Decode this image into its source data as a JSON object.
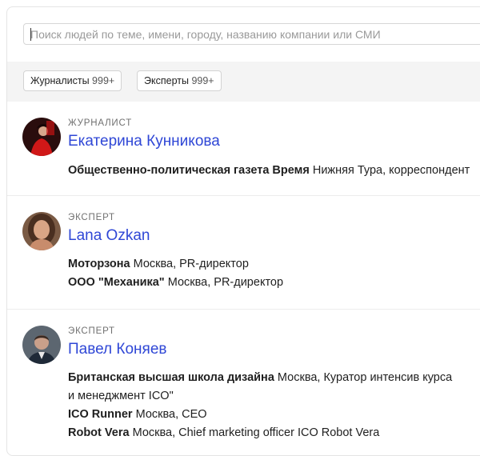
{
  "search": {
    "placeholder": "Поиск людей по теме, имени, городу, названию компании или СМИ"
  },
  "filters": [
    {
      "label": "Журналисты",
      "count": "999+"
    },
    {
      "label": "Эксперты",
      "count": "999+"
    }
  ],
  "people": [
    {
      "role": "ЖУРНАЛИСТ",
      "name": "Екатерина Кунникова",
      "jobs": [
        {
          "org": "Общественно-политическая газета Время",
          "details": "Нижняя Тура, корреспондент"
        }
      ]
    },
    {
      "role": "ЭКСПЕРТ",
      "name": "Lana Ozkan",
      "jobs": [
        {
          "org": "Моторзона",
          "details": "Москва, PR-директор"
        },
        {
          "org": "ООО \"Механика\"",
          "details": "Москва, PR-директор"
        }
      ]
    },
    {
      "role": "ЭКСПЕРТ",
      "name": "Павел Коняев",
      "jobs": [
        {
          "org": "Британская высшая школа дизайна",
          "details": "Москва, Куратор интенсив курса"
        },
        {
          "org": "",
          "details": "и менеджмент ICO\""
        },
        {
          "org": "ICO Runner",
          "details": "Москва, CEO"
        },
        {
          "org": "Robot Vera",
          "details": "Москва, Chief marketing officer ICO Robot Vera"
        }
      ]
    }
  ],
  "colors": {
    "accent": "#2f47d6",
    "filter_bg": "#f4f4f4"
  },
  "icons": [
    "avatar-photo"
  ]
}
